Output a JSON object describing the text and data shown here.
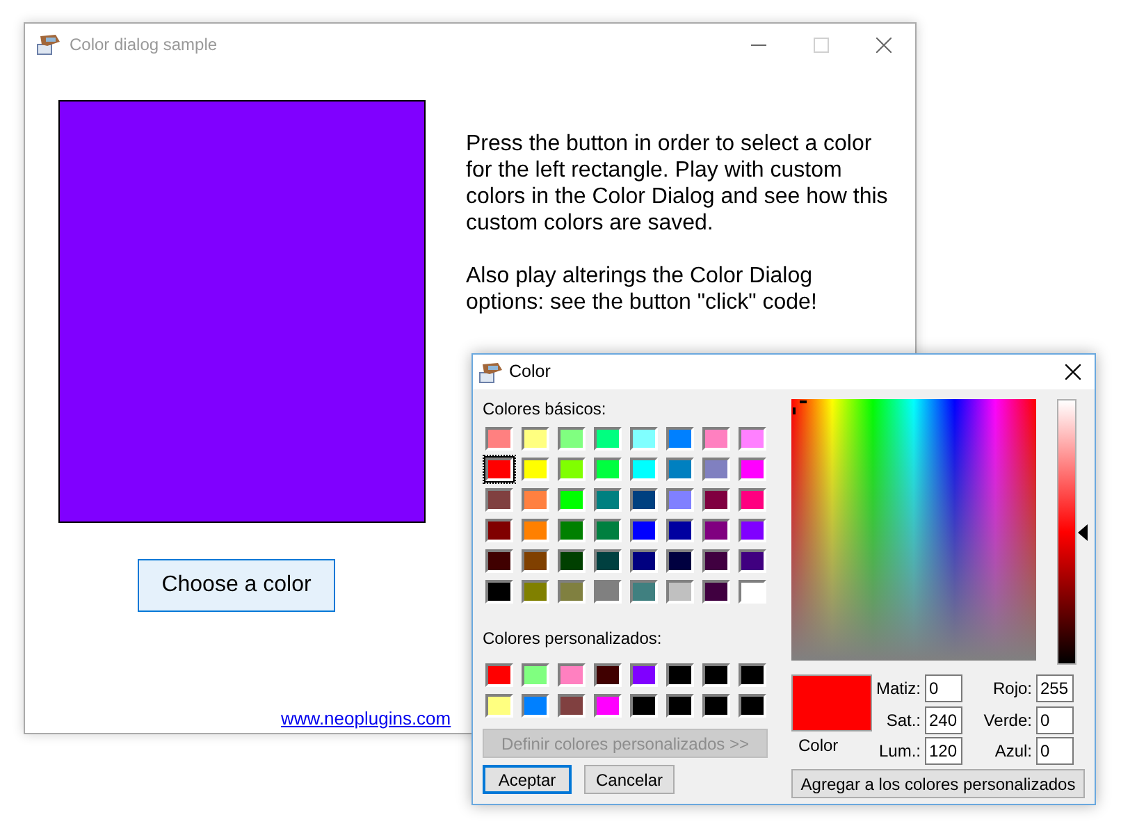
{
  "main_window": {
    "title": "Color dialog sample",
    "maximize_disabled": true,
    "rectangle": {
      "color": "#8000ff"
    },
    "paragraphs": [
      "Press the button in order to select a color for the left rectangle. Play with custom colors in the Color Dialog and see how this custom colors are saved.",
      "Also play alterings the Color Dialog options: see the button \"click\" code!"
    ],
    "button": "Choose a color",
    "link": "www.neoplugins.com"
  },
  "color_dialog": {
    "title": "Color",
    "basic_label": "Colores básicos:",
    "basic_colors": [
      {
        "color": "#ff8080",
        "selected": false
      },
      {
        "color": "#ffff80",
        "selected": false
      },
      {
        "color": "#80ff80",
        "selected": false
      },
      {
        "color": "#00ff80",
        "selected": false
      },
      {
        "color": "#80ffff",
        "selected": false
      },
      {
        "color": "#0080ff",
        "selected": false
      },
      {
        "color": "#ff80c0",
        "selected": false
      },
      {
        "color": "#ff80ff",
        "selected": false
      },
      {
        "color": "#ff0000",
        "selected": true
      },
      {
        "color": "#ffff00",
        "selected": false
      },
      {
        "color": "#80ff00",
        "selected": false
      },
      {
        "color": "#00ff40",
        "selected": false
      },
      {
        "color": "#00ffff",
        "selected": false
      },
      {
        "color": "#0080c0",
        "selected": false
      },
      {
        "color": "#8080c0",
        "selected": false
      },
      {
        "color": "#ff00ff",
        "selected": false
      },
      {
        "color": "#804040",
        "selected": false
      },
      {
        "color": "#ff8040",
        "selected": false
      },
      {
        "color": "#00ff00",
        "selected": false
      },
      {
        "color": "#008080",
        "selected": false
      },
      {
        "color": "#004080",
        "selected": false
      },
      {
        "color": "#8080ff",
        "selected": false
      },
      {
        "color": "#800040",
        "selected": false
      },
      {
        "color": "#ff0080",
        "selected": false
      },
      {
        "color": "#800000",
        "selected": false
      },
      {
        "color": "#ff8000",
        "selected": false
      },
      {
        "color": "#008000",
        "selected": false
      },
      {
        "color": "#008040",
        "selected": false
      },
      {
        "color": "#0000ff",
        "selected": false
      },
      {
        "color": "#0000a0",
        "selected": false
      },
      {
        "color": "#800080",
        "selected": false
      },
      {
        "color": "#8000ff",
        "selected": false
      },
      {
        "color": "#400000",
        "selected": false
      },
      {
        "color": "#804000",
        "selected": false
      },
      {
        "color": "#004000",
        "selected": false
      },
      {
        "color": "#004040",
        "selected": false
      },
      {
        "color": "#000080",
        "selected": false
      },
      {
        "color": "#000040",
        "selected": false
      },
      {
        "color": "#400040",
        "selected": false
      },
      {
        "color": "#400080",
        "selected": false
      },
      {
        "color": "#000000",
        "selected": false
      },
      {
        "color": "#808000",
        "selected": false
      },
      {
        "color": "#808040",
        "selected": false
      },
      {
        "color": "#808080",
        "selected": false
      },
      {
        "color": "#408080",
        "selected": false
      },
      {
        "color": "#c0c0c0",
        "selected": false
      },
      {
        "color": "#400040",
        "selected": false
      },
      {
        "color": "#ffffff",
        "selected": false
      }
    ],
    "custom_label": "Colores personalizados:",
    "custom_colors": [
      {
        "color": "#ff0000",
        "selected": false
      },
      {
        "color": "#80ff80",
        "selected": false
      },
      {
        "color": "#ff80c0",
        "selected": false
      },
      {
        "color": "#400000",
        "selected": false
      },
      {
        "color": "#8000ff",
        "selected": false
      },
      {
        "color": "#000000",
        "selected": false
      },
      {
        "color": "#000000",
        "selected": false
      },
      {
        "color": "#000000",
        "selected": false
      },
      {
        "color": "#ffff80",
        "selected": false
      },
      {
        "color": "#0080ff",
        "selected": false
      },
      {
        "color": "#804040",
        "selected": false
      },
      {
        "color": "#ff00ff",
        "selected": false
      },
      {
        "color": "#000000",
        "selected": false
      },
      {
        "color": "#000000",
        "selected": false
      },
      {
        "color": "#000000",
        "selected": false
      },
      {
        "color": "#000000",
        "selected": false
      }
    ],
    "define_button": {
      "label": "Definir colores personalizados >>",
      "disabled": true
    },
    "ok_button": {
      "label": "Aceptar",
      "default": true
    },
    "cancel_button": {
      "label": "Cancelar",
      "default": false
    },
    "luminance": {
      "level": 0.5
    },
    "preview": {
      "color": "#ff0000",
      "label": "Color"
    },
    "fields": [
      {
        "label": "Matiz:",
        "value": "0"
      },
      {
        "label": "Rojo:",
        "value": "255"
      },
      {
        "label": "Sat.:",
        "value": "240"
      },
      {
        "label": "Verde:",
        "value": "0"
      },
      {
        "label": "Lum.:",
        "value": "120"
      },
      {
        "label": "Azul:",
        "value": "0"
      }
    ],
    "add_button": "Agregar a los colores personalizados"
  }
}
